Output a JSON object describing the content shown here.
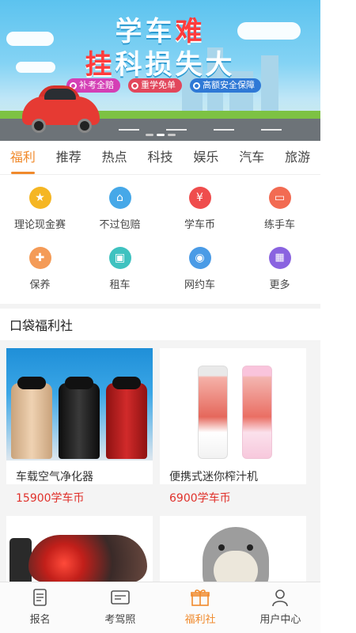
{
  "banner": {
    "title_line1_a": "学",
    "title_line1_b": "车",
    "title_line1_c": "难",
    "title_line2_a": "挂",
    "title_line2_b": "科",
    "title_line2_c": "损",
    "title_line2_d": "失",
    "title_line2_e": "大",
    "pills": [
      {
        "label": "补考全赔",
        "color": "#d43fb5"
      },
      {
        "label": "重学免单",
        "color": "#e2475c"
      },
      {
        "label": "高额安全保障",
        "color": "#2f79d6"
      }
    ]
  },
  "tabs": [
    {
      "label": "福利"
    },
    {
      "label": "推荐"
    },
    {
      "label": "热点"
    },
    {
      "label": "科技"
    },
    {
      "label": "娱乐"
    },
    {
      "label": "汽车"
    },
    {
      "label": "旅游"
    }
  ],
  "grid": [
    {
      "label": "理论现金赛",
      "icon": "trophy-icon",
      "color": "#f5b623",
      "glyph": "🏆"
    },
    {
      "label": "不过包赔",
      "icon": "home-icon",
      "color": "#46a8e8",
      "glyph": "⌂"
    },
    {
      "label": "学车币",
      "icon": "coin-icon",
      "color": "#ef4d4d",
      "glyph": "¥"
    },
    {
      "label": "练手车",
      "icon": "car-icon",
      "color": "#f26b52",
      "glyph": "🚗"
    },
    {
      "label": "保养",
      "icon": "wrench-car-icon",
      "color": "#f49b57",
      "glyph": "🔧"
    },
    {
      "label": "租车",
      "icon": "rental-car-icon",
      "color": "#3fc2c0",
      "glyph": "🚘"
    },
    {
      "label": "网约车",
      "icon": "ride-hailing-icon",
      "color": "#4a9be6",
      "glyph": "🚕"
    },
    {
      "label": "更多",
      "icon": "more-grid-icon",
      "color": "#8a63e0",
      "glyph": "▦"
    }
  ],
  "section": {
    "title": "口袋福利社"
  },
  "products": [
    {
      "name": "车载空气净化器",
      "price": "15900学车币"
    },
    {
      "name": "便携式迷你榨汁机",
      "price": "6900学车币"
    },
    {
      "name": "",
      "price": ""
    },
    {
      "name": "",
      "price": ""
    }
  ],
  "bottom_nav": [
    {
      "label": "报名",
      "icon": "signup-icon"
    },
    {
      "label": "考驾照",
      "icon": "license-card-icon"
    },
    {
      "label": "福利社",
      "icon": "gift-icon"
    },
    {
      "label": "用户中心",
      "icon": "user-icon"
    }
  ],
  "colors": {
    "accent": "#f08a2c",
    "price": "#e0312b"
  }
}
